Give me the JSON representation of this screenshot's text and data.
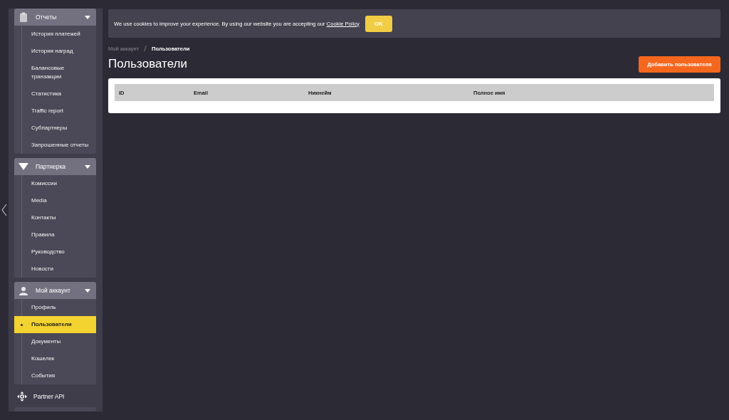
{
  "sidebar": {
    "groups": [
      {
        "label": "Отчеты",
        "expanded": true,
        "items": [
          {
            "label": "История платежей",
            "selected": false
          },
          {
            "label": "История наград",
            "selected": false
          },
          {
            "label": "Балансовые транзакции",
            "selected": false
          },
          {
            "label": "Статистика",
            "selected": false
          },
          {
            "label": "Traffic report",
            "selected": false
          },
          {
            "label": "Субпартнеры",
            "selected": false
          },
          {
            "label": "Запрошенные отчеты",
            "selected": false
          }
        ]
      },
      {
        "label": "Партнерка",
        "expanded": true,
        "items": [
          {
            "label": "Комиссии",
            "selected": false
          },
          {
            "label": "Media",
            "selected": false
          },
          {
            "label": "Контакты",
            "selected": false
          },
          {
            "label": "Правила",
            "selected": false
          },
          {
            "label": "Руководство",
            "selected": false
          },
          {
            "label": "Новости",
            "selected": false
          }
        ]
      },
      {
        "label": "Мой аккаунт",
        "expanded": true,
        "items": [
          {
            "label": "Профиль",
            "selected": false
          },
          {
            "label": "Пользователи",
            "selected": true
          },
          {
            "label": "Документы",
            "selected": false
          },
          {
            "label": "Кошелек",
            "selected": false
          },
          {
            "label": "События",
            "selected": false
          }
        ]
      }
    ],
    "links": [
      {
        "label": "Partner API"
      }
    ]
  },
  "cookie_banner": {
    "text": "We use cookies to improve your experience. By using our website you are accepting our",
    "link": "Cookie Policy",
    "button": "OK"
  },
  "breadcrumb": [
    "Мой аккаунт",
    "Пользователи"
  ],
  "page_title": "Пользователи",
  "add_button": "Добавить пользователя",
  "table": {
    "columns": [
      "ID",
      "Email",
      "Никнейм",
      "Полное имя"
    ]
  }
}
